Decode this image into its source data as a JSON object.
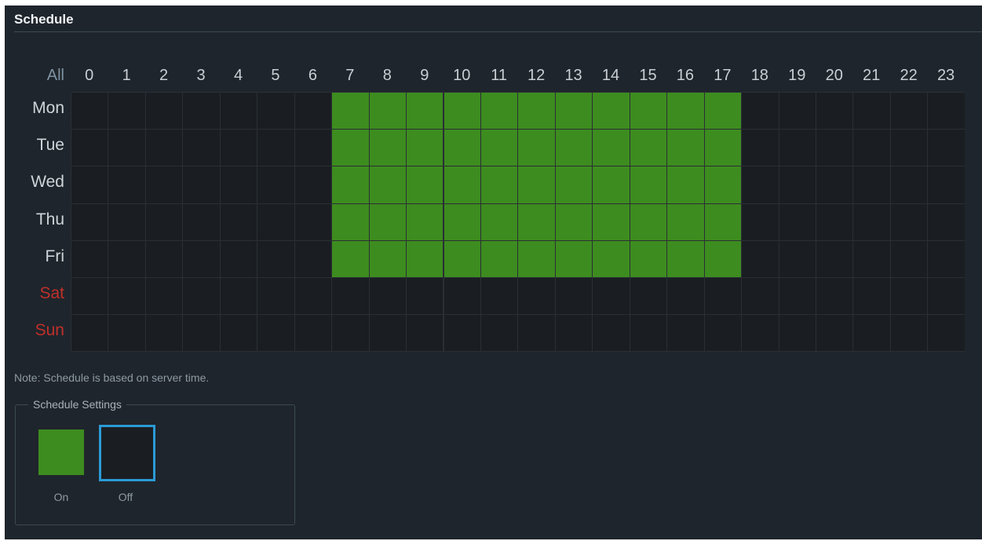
{
  "panel": {
    "title": "Schedule"
  },
  "header": {
    "all_label": "All",
    "hours": [
      "0",
      "1",
      "2",
      "3",
      "4",
      "5",
      "6",
      "7",
      "8",
      "9",
      "10",
      "11",
      "12",
      "13",
      "14",
      "15",
      "16",
      "17",
      "18",
      "19",
      "20",
      "21",
      "22",
      "23"
    ]
  },
  "days": [
    {
      "label": "Mon",
      "weekend": false
    },
    {
      "label": "Tue",
      "weekend": false
    },
    {
      "label": "Wed",
      "weekend": false
    },
    {
      "label": "Thu",
      "weekend": false
    },
    {
      "label": "Fri",
      "weekend": false
    },
    {
      "label": "Sat",
      "weekend": true
    },
    {
      "label": "Sun",
      "weekend": true
    }
  ],
  "schedule": [
    [
      0,
      0,
      0,
      0,
      0,
      0,
      0,
      1,
      1,
      1,
      1,
      1,
      1,
      1,
      1,
      1,
      1,
      1,
      0,
      0,
      0,
      0,
      0,
      0
    ],
    [
      0,
      0,
      0,
      0,
      0,
      0,
      0,
      1,
      1,
      1,
      1,
      1,
      1,
      1,
      1,
      1,
      1,
      1,
      0,
      0,
      0,
      0,
      0,
      0
    ],
    [
      0,
      0,
      0,
      0,
      0,
      0,
      0,
      1,
      1,
      1,
      1,
      1,
      1,
      1,
      1,
      1,
      1,
      1,
      0,
      0,
      0,
      0,
      0,
      0
    ],
    [
      0,
      0,
      0,
      0,
      0,
      0,
      0,
      1,
      1,
      1,
      1,
      1,
      1,
      1,
      1,
      1,
      1,
      1,
      0,
      0,
      0,
      0,
      0,
      0
    ],
    [
      0,
      0,
      0,
      0,
      0,
      0,
      0,
      1,
      1,
      1,
      1,
      1,
      1,
      1,
      1,
      1,
      1,
      1,
      0,
      0,
      0,
      0,
      0,
      0
    ],
    [
      0,
      0,
      0,
      0,
      0,
      0,
      0,
      0,
      0,
      0,
      0,
      0,
      0,
      0,
      0,
      0,
      0,
      0,
      0,
      0,
      0,
      0,
      0,
      0
    ],
    [
      0,
      0,
      0,
      0,
      0,
      0,
      0,
      0,
      0,
      0,
      0,
      0,
      0,
      0,
      0,
      0,
      0,
      0,
      0,
      0,
      0,
      0,
      0,
      0
    ]
  ],
  "note": "Note: Schedule is based on server time.",
  "settings": {
    "legend": "Schedule Settings",
    "on_label": "On",
    "off_label": "Off",
    "selected": "off"
  },
  "colors": {
    "on": "#3d8c1f",
    "off": "#1a1e22",
    "weekend_text": "#c0302a",
    "selected_border": "#2a9bd6"
  }
}
